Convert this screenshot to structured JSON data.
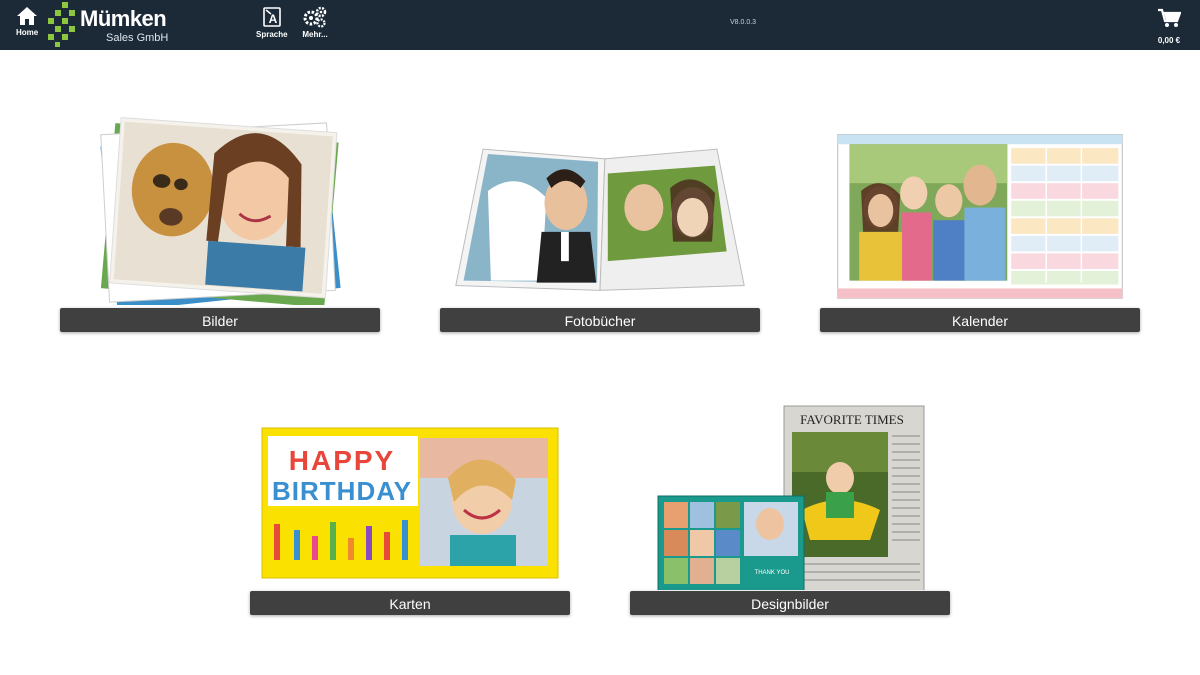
{
  "nav": {
    "home_label": "Home",
    "language_label": "Sprache",
    "more_label": "Mehr...",
    "version": "V8.0.0.3",
    "cart_total": "0,00 €"
  },
  "logo": {
    "brand": "Mümken",
    "subtitle": "Sales GmbH"
  },
  "colors": {
    "topbar": "#1c2a38",
    "accent_green": "#8dc63f",
    "shelf": "#404040"
  },
  "products": [
    {
      "label": "Bilder"
    },
    {
      "label": "Fotobücher"
    },
    {
      "label": "Kalender"
    },
    {
      "label": "Karten"
    },
    {
      "label": "Designbilder"
    }
  ],
  "artwork": {
    "birthday_line1": "HAPPY",
    "birthday_line2": "BIRTHDAY",
    "newspaper_title": "FAVORITE TIMES",
    "thank_you": "THANK YOU"
  }
}
